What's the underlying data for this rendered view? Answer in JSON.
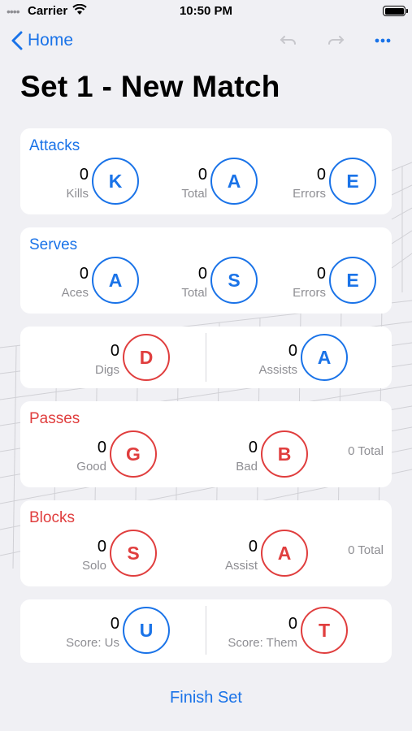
{
  "status_bar": {
    "carrier": "Carrier",
    "time": "10:50 PM"
  },
  "nav": {
    "back_label": "Home"
  },
  "title": "Set 1 - New Match",
  "attacks": {
    "header": "Attacks",
    "stats": [
      {
        "count": "0",
        "label": "Kills",
        "button": "K"
      },
      {
        "count": "0",
        "label": "Total",
        "button": "A"
      },
      {
        "count": "0",
        "label": "Errors",
        "button": "E"
      }
    ]
  },
  "serves": {
    "header": "Serves",
    "stats": [
      {
        "count": "0",
        "label": "Aces",
        "button": "A"
      },
      {
        "count": "0",
        "label": "Total",
        "button": "S"
      },
      {
        "count": "0",
        "label": "Errors",
        "button": "E"
      }
    ]
  },
  "defense": {
    "stats": [
      {
        "count": "0",
        "label": "Digs",
        "button": "D"
      },
      {
        "count": "0",
        "label": "Assists",
        "button": "A"
      }
    ]
  },
  "passes": {
    "header": "Passes",
    "stats": [
      {
        "count": "0",
        "label": "Good",
        "button": "G"
      },
      {
        "count": "0",
        "label": "Bad",
        "button": "B"
      }
    ],
    "total": "0 Total"
  },
  "blocks": {
    "header": "Blocks",
    "stats": [
      {
        "count": "0",
        "label": "Solo",
        "button": "S"
      },
      {
        "count": "0",
        "label": "Assist",
        "button": "A"
      }
    ],
    "total": "0 Total"
  },
  "score": {
    "stats": [
      {
        "count": "0",
        "label": "Score: Us",
        "button": "U"
      },
      {
        "count": "0",
        "label": "Score: Them",
        "button": "T"
      }
    ]
  },
  "finish_label": "Finish Set",
  "colors": {
    "accent_blue": "#1a73e8",
    "accent_red": "#e03e3e",
    "background": "#f0f0f4"
  }
}
